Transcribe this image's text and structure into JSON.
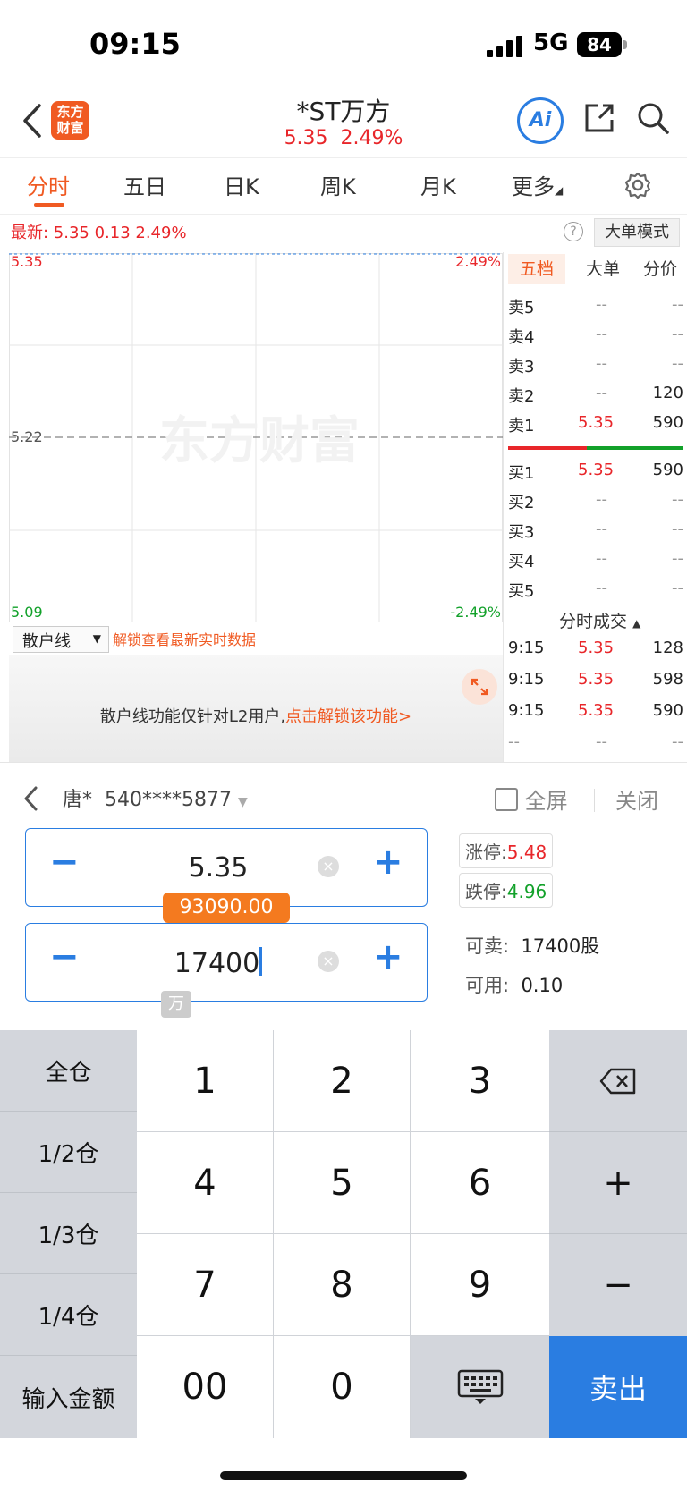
{
  "status_bar": {
    "time": "09:15",
    "network": "5G",
    "battery": "84"
  },
  "header": {
    "logo_line1": "东方",
    "logo_line2": "财富",
    "stock_name": "*ST万方",
    "price": "5.35",
    "change_pct": "2.49%",
    "ai_label": "Ai"
  },
  "tabs": [
    "分时",
    "五日",
    "日K",
    "周K",
    "月K",
    "更多"
  ],
  "chart": {
    "latest_label": "最新: 5.35  0.13  2.49%",
    "big_order_mode": "大单模式",
    "help": "?",
    "y_top": "5.35",
    "y_mid": "5.22",
    "y_bottom": "5.09",
    "pct_top": "2.49%",
    "pct_bottom": "-2.49%",
    "watermark": "东方财富",
    "retail_line": "散户线",
    "unlock_hint": "解锁查看最新实时数据",
    "lock_text": "散户线功能仅针对L2用户,",
    "lock_link": "点击解锁该功能>"
  },
  "order_book": {
    "tabs": [
      "五档",
      "大单",
      "分价"
    ],
    "sell": [
      {
        "label": "卖5",
        "price": "--",
        "vol": "--"
      },
      {
        "label": "卖4",
        "price": "--",
        "vol": "--"
      },
      {
        "label": "卖3",
        "price": "--",
        "vol": "--"
      },
      {
        "label": "卖2",
        "price": "--",
        "vol": "120"
      },
      {
        "label": "卖1",
        "price": "5.35",
        "vol": "590"
      }
    ],
    "buy": [
      {
        "label": "买1",
        "price": "5.35",
        "vol": "590"
      },
      {
        "label": "买2",
        "price": "--",
        "vol": "--"
      },
      {
        "label": "买3",
        "price": "--",
        "vol": "--"
      },
      {
        "label": "买4",
        "price": "--",
        "vol": "--"
      },
      {
        "label": "买5",
        "price": "--",
        "vol": "--"
      }
    ],
    "ticks_title": "分时成交",
    "ticks": [
      {
        "time": "9:15",
        "price": "5.35",
        "vol": "128"
      },
      {
        "time": "9:15",
        "price": "5.35",
        "vol": "598"
      },
      {
        "time": "9:15",
        "price": "5.35",
        "vol": "590"
      },
      {
        "time": "--",
        "price": "--",
        "vol": "--"
      }
    ]
  },
  "trade": {
    "account_name": "唐*",
    "account_no": "540****5877",
    "fullscreen": "全屏",
    "close": "关闭",
    "price_value": "5.35",
    "amount_tooltip": "93090.00",
    "qty_value": "17400",
    "unit_hint": "万",
    "limit_up_label": "涨停:",
    "limit_up_value": "5.48",
    "limit_down_label": "跌停:",
    "limit_down_value": "4.96",
    "sellable_label": "可卖:",
    "sellable_value": "17400股",
    "available_label": "可用:",
    "available_value": "0.10"
  },
  "keypad": {
    "side": [
      "全仓",
      "1/2仓",
      "1/3仓",
      "1/4仓",
      "输入金额"
    ],
    "digits": [
      "1",
      "2",
      "3",
      "4",
      "5",
      "6",
      "7",
      "8",
      "9",
      "00",
      "0"
    ],
    "plus": "+",
    "minus": "−",
    "sell": "卖出"
  },
  "colors": {
    "accent": "#2a7de1",
    "brand": "#f05a22",
    "up": "#e8262a",
    "down": "#12a12a"
  }
}
